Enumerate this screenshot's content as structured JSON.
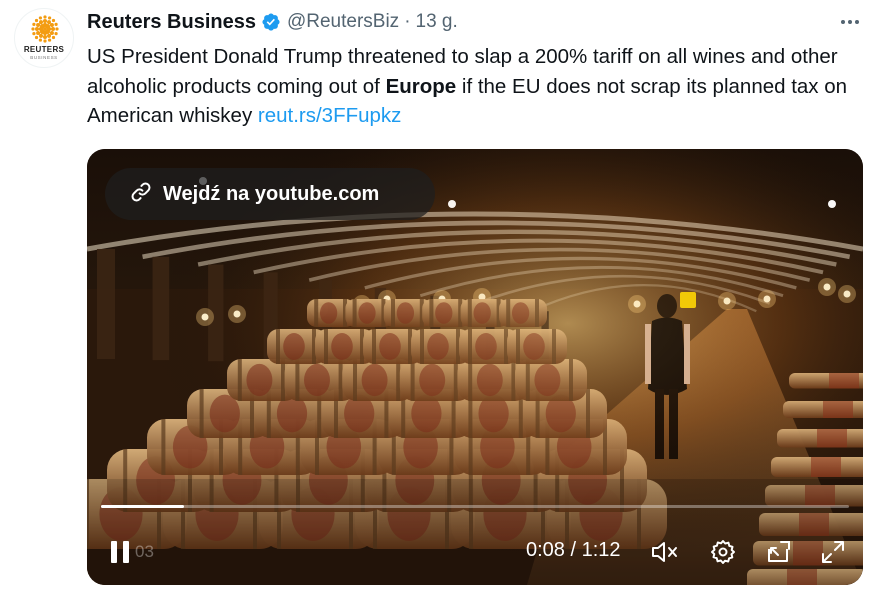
{
  "tweet": {
    "author_name": "Reuters Business",
    "handle": "@ReutersBiz",
    "separator": "·",
    "timestamp": "13 g.",
    "avatar": {
      "logo_text": "REUTERS",
      "logo_sub": "BUSINESS",
      "color": "#f39c12"
    },
    "text": {
      "part1": "US President Donald Trump threatened to slap a 200% tariff on all wines and other alcoholic products coming out of ",
      "bold": "Europe",
      "part2": " if the EU does not scrap its planned tax on American whiskey ",
      "link": "reut.rs/3FFupkz"
    },
    "icons": {
      "verified": "verified-badge-icon",
      "more": "more-options-icon"
    }
  },
  "media": {
    "youtube_link_label": "Wejdź na youtube.com",
    "watermark": "03",
    "current_time": "0:08",
    "duration": "1:12",
    "time_separator": " / ",
    "progress_fraction": 0.111,
    "icons": [
      "link-icon",
      "pause-icon",
      "mute-icon",
      "settings-icon",
      "pip-icon",
      "fullscreen-icon"
    ]
  },
  "colors": {
    "link": "#1d9bf0",
    "verified": "#1d9bf0",
    "secondary_text": "#536471"
  }
}
